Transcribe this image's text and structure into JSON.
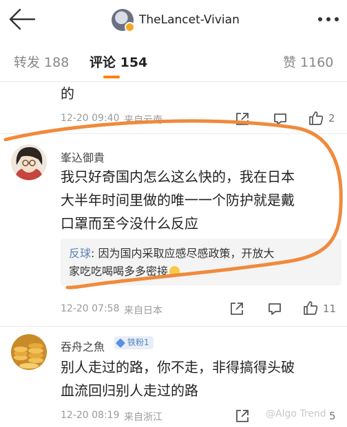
{
  "header": {
    "title": "TheLancet-Vivian"
  },
  "tabs": [
    {
      "label": "转发 188"
    },
    {
      "label": "评论 154"
    },
    {
      "label": "赞 1160"
    }
  ],
  "comments": [
    {
      "tail_text": "的",
      "date": "12-20 09:40",
      "source": "来自云南",
      "likes": "2"
    },
    {
      "username": "峯込御貴",
      "text_lines": [
        "我只好奇国内怎么这么快的，我在日本",
        "大半年时间里做的唯一一个防护就是戴",
        "口罩而至今没什么反应"
      ],
      "reply": {
        "name": "反球",
        "line1": ": 因为国内采取应感尽感政策，开放大",
        "line2": "家吃吃喝喝多多密接"
      },
      "date": "12-20 07:58",
      "source": "来自日本",
      "likes": "11"
    },
    {
      "username": "吞舟之魚",
      "badge": "铁粉1",
      "text_lines": [
        "别人走过的路，你不走，非得搞得头破",
        "血流回归别人走过的路"
      ],
      "date": "12-20 08:19",
      "source": "来自浙江",
      "likes": "5"
    }
  ],
  "watermark": "@Algo Trend",
  "colors": {
    "accent": "#ff8200",
    "annotation": "#f08a3c",
    "link": "#5b82b8"
  }
}
